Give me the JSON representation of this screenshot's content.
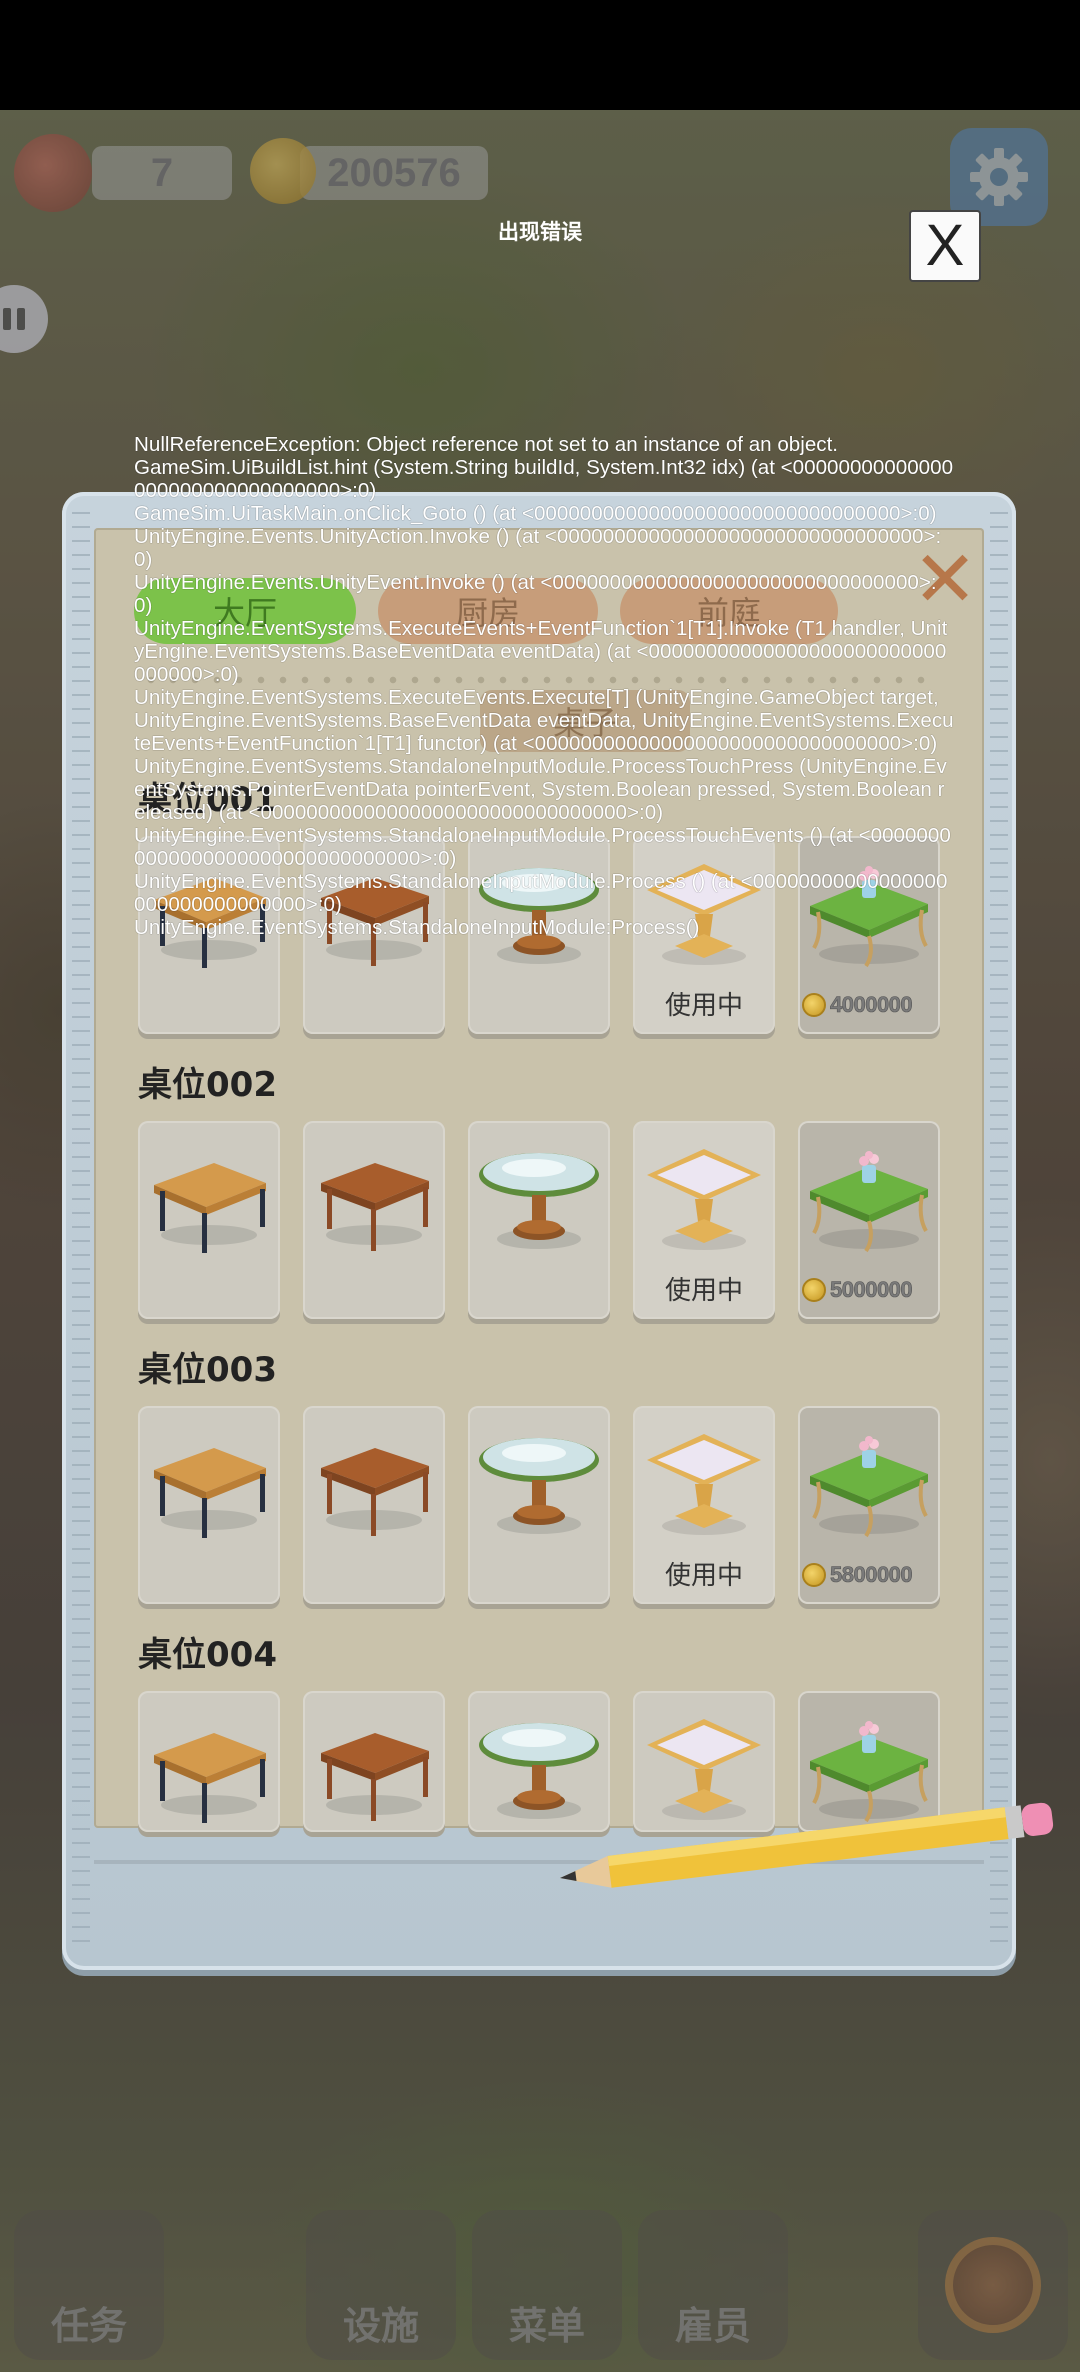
{
  "hud": {
    "level_value": "7",
    "coins_value": "200576"
  },
  "bottom_nav": {
    "tasks_label": "任务",
    "facilities_label": "设施",
    "menu_label": "菜单",
    "staff_label": "雇员"
  },
  "build_panel": {
    "tabs": [
      {
        "label": "大厅",
        "active": true
      },
      {
        "label": "厨房",
        "active": false
      },
      {
        "label": "前庭",
        "active": false
      }
    ],
    "subtab_label": "桌子",
    "sections": [
      {
        "title": "桌位001",
        "items": [
          {
            "icon": "dark-leg-wooden-table-icon",
            "status": ""
          },
          {
            "icon": "brown-wooden-table-icon",
            "status": ""
          },
          {
            "icon": "round-glass-table-icon",
            "status": ""
          },
          {
            "icon": "gold-glass-table-icon",
            "status": "使用中"
          },
          {
            "icon": "green-ornate-table-icon",
            "price": "4000000"
          }
        ]
      },
      {
        "title": "桌位002",
        "items": [
          {
            "icon": "dark-leg-wooden-table-icon",
            "status": ""
          },
          {
            "icon": "brown-wooden-table-icon",
            "status": ""
          },
          {
            "icon": "round-glass-table-icon",
            "status": ""
          },
          {
            "icon": "gold-glass-table-icon",
            "status": "使用中"
          },
          {
            "icon": "green-ornate-table-icon",
            "price": "5000000"
          }
        ]
      },
      {
        "title": "桌位003",
        "items": [
          {
            "icon": "dark-leg-wooden-table-icon",
            "status": ""
          },
          {
            "icon": "brown-wooden-table-icon",
            "status": ""
          },
          {
            "icon": "round-glass-table-icon",
            "status": ""
          },
          {
            "icon": "gold-glass-table-icon",
            "status": "使用中"
          },
          {
            "icon": "green-ornate-table-icon",
            "price": "5800000"
          }
        ]
      },
      {
        "title": "桌位004",
        "items": [
          {
            "icon": "dark-leg-wooden-table-icon",
            "status": ""
          },
          {
            "icon": "brown-wooden-table-icon",
            "status": ""
          },
          {
            "icon": "round-glass-table-icon",
            "status": ""
          },
          {
            "icon": "gold-glass-table-icon",
            "status": ""
          },
          {
            "icon": "green-ornate-table-icon",
            "price": ""
          }
        ]
      }
    ]
  },
  "error_dialog": {
    "title": "出现错误",
    "close_label": "X",
    "message": "NullReferenceException: Object reference not set to an instance of an object.\nGameSim.UiBuildList.hint (System.String buildId, System.Int32 idx) (at <00000000000000000000000000000000>:0)\nGameSim.UiTaskMain.onClick_Goto () (at <00000000000000000000000000000000>:0)\nUnityEngine.Events.UnityAction.Invoke () (at <00000000000000000000000000000000>:0)\nUnityEngine.Events.UnityEvent.Invoke () (at <00000000000000000000000000000000>:0)\nUnityEngine.EventSystems.ExecuteEvents+EventFunction`1[T1].Invoke (T1 handler, UnityEngine.EventSystems.BaseEventData eventData) (at <00000000000000000000000000000000>:0)\nUnityEngine.EventSystems.ExecuteEvents.Execute[T] (UnityEngine.GameObject target, UnityEngine.EventSystems.BaseEventData eventData, UnityEngine.EventSystems.ExecuteEvents+EventFunction`1[T1] functor) (at <00000000000000000000000000000000>:0)\nUnityEngine.EventSystems.StandaloneInputModule.ProcessTouchPress (UnityEngine.EventSystems.PointerEventData pointerEvent, System.Boolean pressed, System.Boolean released) (at <00000000000000000000000000000000>:0)\nUnityEngine.EventSystems.StandaloneInputModule.ProcessTouchEvents () (at <00000000000000000000000000000000>:0)\nUnityEngine.EventSystems.StandaloneInputModule.Process () (at <00000000000000000000000000000000>:0)\nUnityEngine.EventSystems.StandaloneInputModule:Process()"
  }
}
